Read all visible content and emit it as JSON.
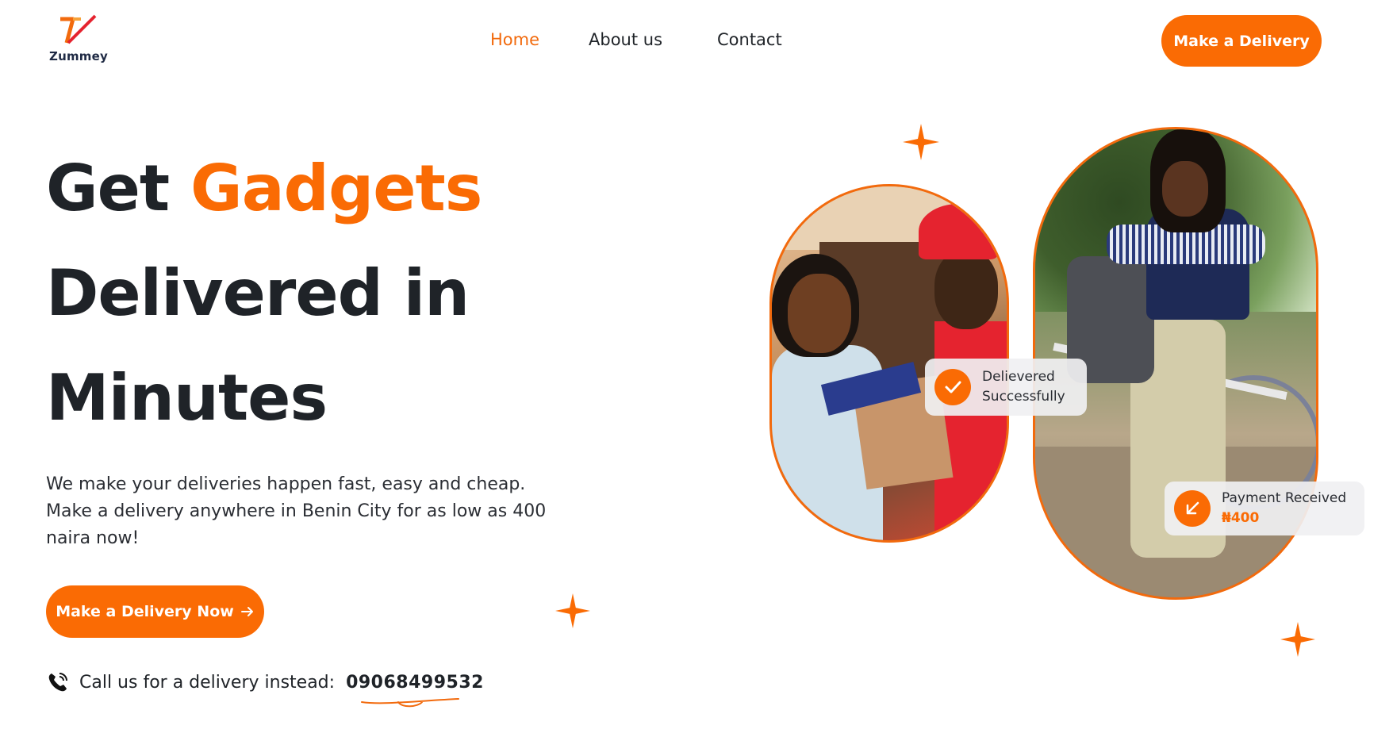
{
  "header": {
    "logo_text": "Zummey",
    "nav": [
      {
        "label": "Home",
        "active": true
      },
      {
        "label": "About us",
        "active": false
      },
      {
        "label": "Contact",
        "active": false
      }
    ],
    "cta_label": "Make a Delivery"
  },
  "hero": {
    "headline_word1": "Get",
    "headline_accent": "Gadgets",
    "headline_line2": "Delivered in",
    "headline_line3": "Minutes",
    "description": "We make your deliveries happen fast, easy and cheap. Make a delivery anywhere in Benin City for as low as 400 naira now!",
    "cta_label": "Make a Delivery Now",
    "cta_icon": "arrow-right-icon",
    "call_text": "Call us for a delivery instead:",
    "call_number": "09068499532",
    "call_icon": "phone-icon"
  },
  "badges": {
    "delivered_line1": "Delievered",
    "delivered_line2": "Successfully",
    "delivered_icon": "checkmark-icon",
    "payment_label": "Payment Received",
    "payment_amount": "₦400",
    "payment_icon": "arrow-down-left-icon"
  },
  "colors": {
    "accent": "#fa6b04",
    "text": "#1f2328"
  }
}
